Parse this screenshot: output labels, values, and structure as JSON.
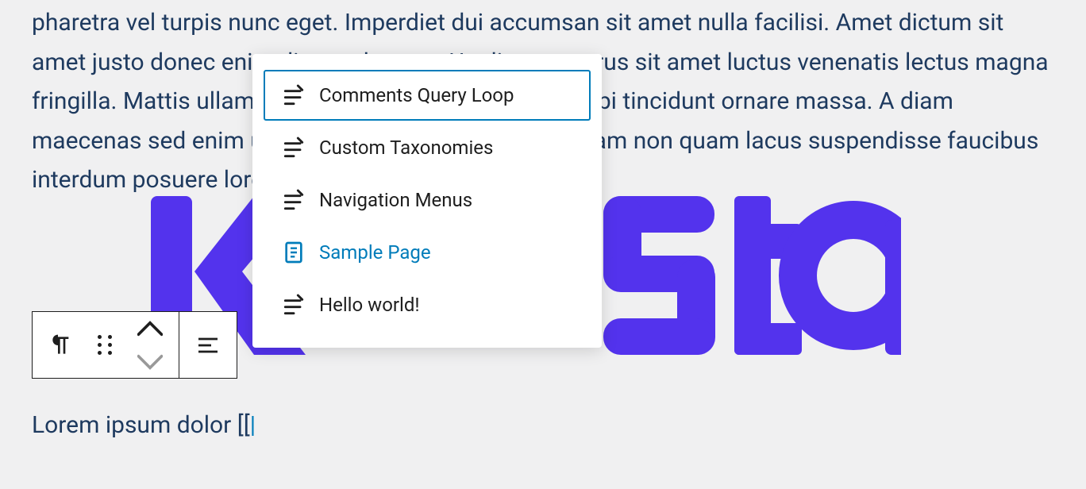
{
  "content": {
    "paragraph": "pharetra vel turpis nunc eget. Imperdiet dui accumsan sit amet nulla facilisi. Amet dictum sit amet justo donec enim diam vulputate. Ut aliquam purus sit amet luctus venenatis lectus magna fringilla. Mattis ullamcorper velit sed ullamcorper morbi tincidunt ornare massa. A diam maecenas sed enim ut sem. Blandit turpis mauris. Etiam non quam lacus suspendisse faucibus interdum posuere lorem.",
    "input_text": "Lorem ipsum dolor [[",
    "caret_char": "|"
  },
  "autocomplete": {
    "items": [
      {
        "label": "Comments Query Loop",
        "icon": "post",
        "selected": true,
        "highlighted": false
      },
      {
        "label": "Custom Taxonomies",
        "icon": "post",
        "selected": false,
        "highlighted": false
      },
      {
        "label": "Navigation Menus",
        "icon": "post",
        "selected": false,
        "highlighted": false
      },
      {
        "label": "Sample Page",
        "icon": "page",
        "selected": false,
        "highlighted": true
      },
      {
        "label": "Hello world!",
        "icon": "post",
        "selected": false,
        "highlighted": false
      }
    ]
  },
  "toolbar": {
    "block_type": "paragraph",
    "move": "move",
    "align": "align"
  }
}
